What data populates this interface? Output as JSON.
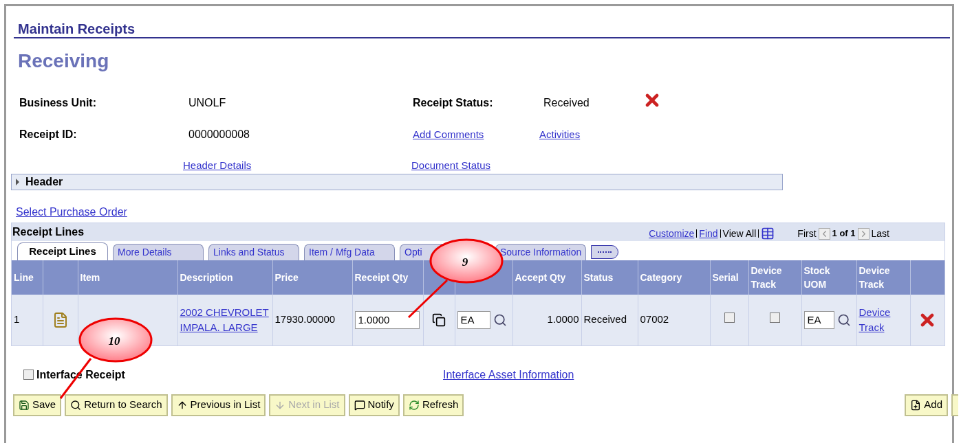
{
  "page_title": "Maintain Receipts",
  "heading": "Receiving",
  "fields": [
    {
      "label": "Business Unit:",
      "value": "UNOLF"
    },
    {
      "label": "Receipt ID:",
      "value": "0000000008"
    }
  ],
  "status": {
    "label": "Receipt Status:",
    "value": "Received"
  },
  "links": {
    "add_comments": "Add Comments",
    "activities": "Activities",
    "header_details": "Header Details",
    "document_status": "Document Status"
  },
  "header_section": {
    "label": "Header",
    "expanded": false
  },
  "select_po": "Select Purchase Order",
  "grid": {
    "title": "Receipt Lines",
    "customize": "Customize",
    "find": "Find",
    "view_all": "View All",
    "first": "First",
    "page": "1 of 1",
    "last": "Last"
  },
  "tabs": [
    {
      "label": "Receipt Lines",
      "selected": true
    },
    {
      "label": "More Details",
      "selected": false
    },
    {
      "label": "Links and Status",
      "selected": false
    },
    {
      "label": "Item / Mfg Data",
      "selected": false
    },
    {
      "label": "Opti",
      "selected": false
    },
    {
      "label": "Source Information",
      "selected": false
    }
  ],
  "columns": [
    {
      "label": "Line"
    },
    {},
    {
      "label": "Item"
    },
    {
      "label": "Description"
    },
    {
      "label": "Price"
    },
    {
      "label": "Receipt Qty"
    },
    {},
    {},
    {
      "label": "Accept Qty"
    },
    {
      "label": "Status"
    },
    {
      "label": "Category"
    },
    {
      "label": "Serial"
    },
    {
      "label": "Device Track"
    },
    {
      "label": "Stock UOM"
    },
    {
      "label": "Device Track"
    },
    {}
  ],
  "rows": [
    {
      "line": "1",
      "description": "2002 CHEVROLET IMPALA. LARGE",
      "price": "17930.00000",
      "receipt_qty": "1.0000",
      "uom": "EA",
      "accept_qty": "1.0000",
      "status": "Received",
      "category": "07002",
      "serial": false,
      "device_track": false,
      "stock_uom": "EA",
      "device_track_link": "Device Track"
    }
  ],
  "interface_receipt": {
    "label": "Interface Receipt",
    "checked": false
  },
  "interface_asset": "Interface Asset Information",
  "buttons": [
    {
      "label": "Save",
      "kind": "save",
      "disabled": false
    },
    {
      "label": "Return to Search",
      "kind": "search",
      "disabled": false
    },
    {
      "label": "Previous in List",
      "kind": "previous",
      "disabled": false
    },
    {
      "label": "Next in List",
      "kind": "next",
      "disabled": true
    },
    {
      "label": "Notify",
      "kind": "notify",
      "disabled": false
    },
    {
      "label": "Refresh",
      "kind": "refresh",
      "disabled": false
    }
  ],
  "add_button": "Add",
  "callouts": [
    {
      "label": "9",
      "kind": "receipt_qty"
    },
    {
      "label": "10",
      "kind": "save"
    }
  ]
}
